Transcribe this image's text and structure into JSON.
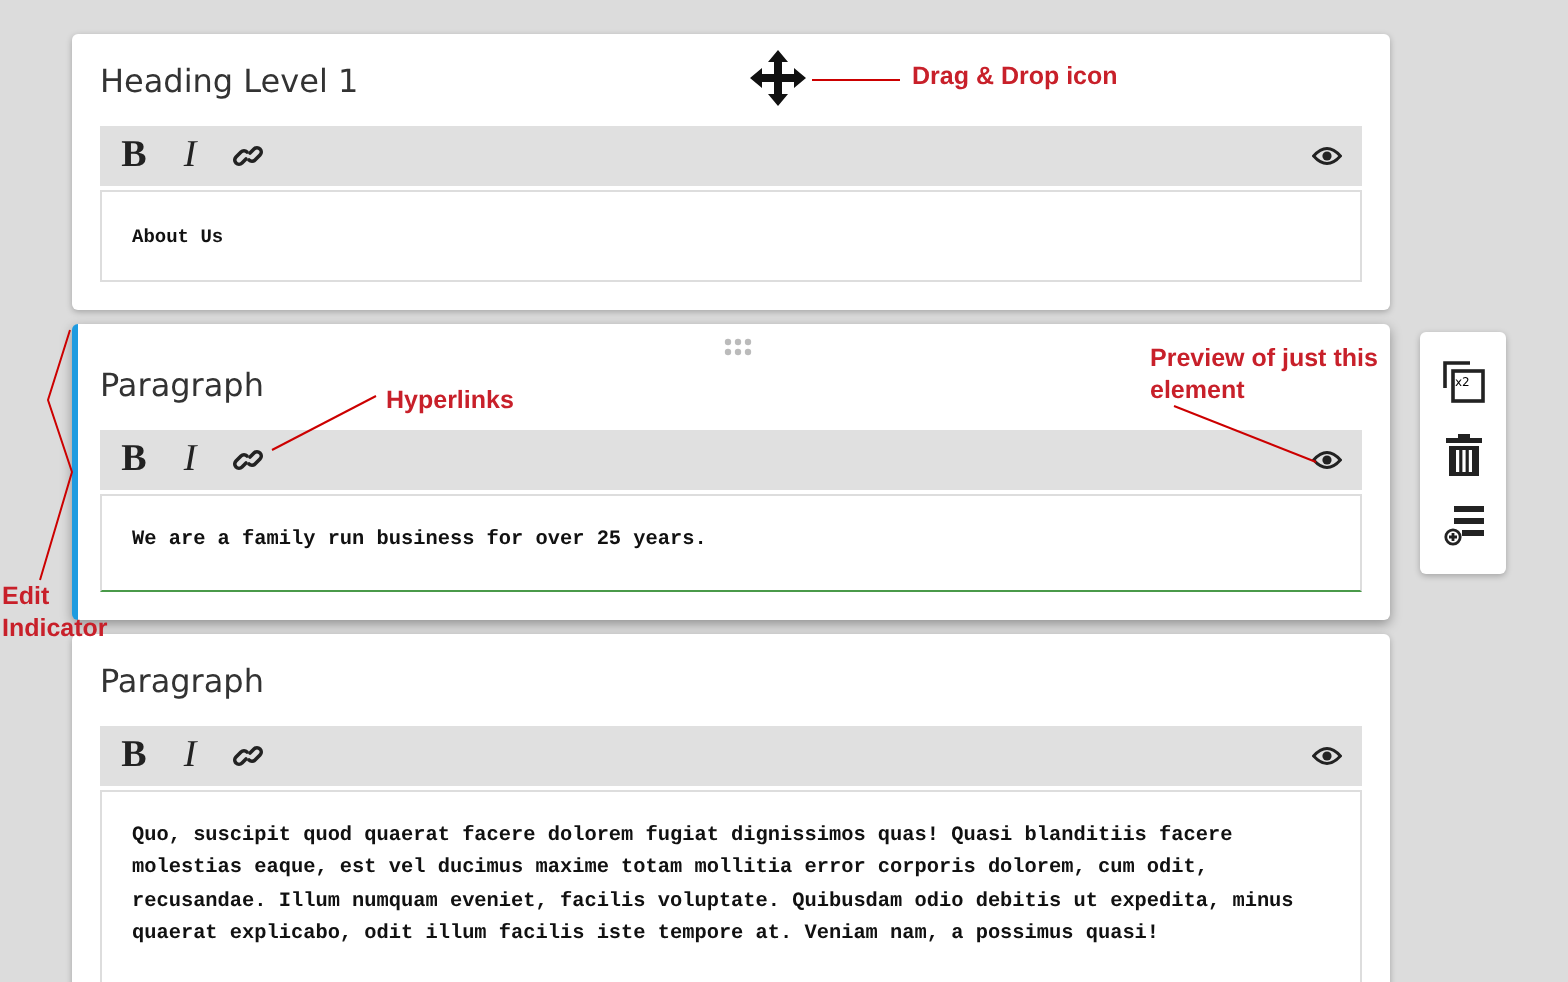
{
  "blocks": [
    {
      "kind": "heading",
      "label": "Heading Level 1",
      "toolbar": [
        "B",
        "I"
      ],
      "content": "About Us",
      "editing": false
    },
    {
      "kind": "paragraph",
      "label": "Paragraph",
      "toolbar": [
        "B",
        "I"
      ],
      "content": "We are a family run business for over 25 years.",
      "editing": true
    },
    {
      "kind": "paragraph",
      "label": "Paragraph",
      "toolbar": [
        "B",
        "I"
      ],
      "content": "Quo, suscipit quod quaerat facere dolorem fugiat dignissimos quas! Quasi blanditiis facere molestias eaque, est vel ducimus maxime totam mollitia error corporis dolorem, cum odit, recusandae. Illum numquam eveniet, facilis voluptate. Quibusdam odio debitis ut expedita, minus quaerat explicabo, odit illum facilis iste tempore at. Veniam nam, a possimus quasi!",
      "editing": false
    }
  ],
  "side_toolbar": {
    "duplicate_badge": "x2"
  },
  "annotations": [
    {
      "text": "Drag & Drop icon"
    },
    {
      "text": "Hyperlinks"
    },
    {
      "text": "Preview of just this element"
    },
    {
      "text": "Edit Indicator"
    }
  ]
}
